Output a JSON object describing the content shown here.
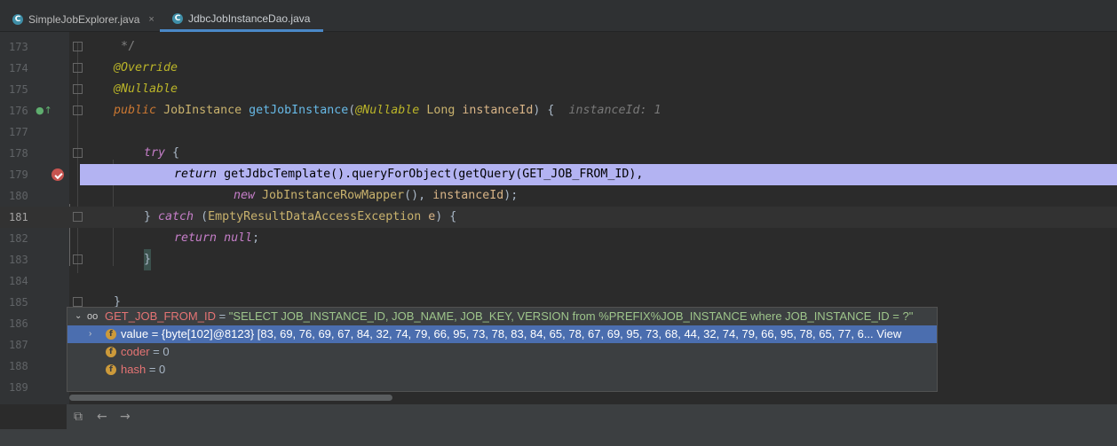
{
  "tabs": [
    {
      "label": "SimpleJobExplorer.java",
      "icon": "c-class-icon",
      "close": "×"
    },
    {
      "label": "JdbcJobInstanceDao.java",
      "icon": "c-class-icon",
      "close": ""
    }
  ],
  "lines": [
    {
      "n": "173"
    },
    {
      "n": "174"
    },
    {
      "n": "175"
    },
    {
      "n": "176"
    },
    {
      "n": "177"
    },
    {
      "n": "178"
    },
    {
      "n": "179"
    },
    {
      "n": "180"
    },
    {
      "n": "181"
    },
    {
      "n": "182"
    },
    {
      "n": "183"
    },
    {
      "n": "184"
    },
    {
      "n": "185"
    },
    {
      "n": "186"
    },
    {
      "n": "187"
    },
    {
      "n": "188"
    },
    {
      "n": "189"
    }
  ],
  "code": {
    "l173": "*/",
    "l174": "@Override",
    "l175": "@Nullable",
    "l176_public": "public",
    "l176_type": "JobInstance",
    "l176_method": "getJobInstance",
    "l176_paren": "(",
    "l176_ann": "@Nullable",
    "l176_long": "Long",
    "l176_param": "instanceId",
    "l176_close": ") {",
    "l176_hint": "instanceId: 1",
    "l178_try": "try",
    "l178_brace": "{",
    "l179_return": "return",
    "l179_rest": "getJdbcTemplate().queryForObject(getQuery(GET_JOB_FROM_ID),",
    "l180_new": "new",
    "l180_type": "JobInstanceRowMapper",
    "l180_rest": "(), ",
    "l180_param": "instanceId",
    "l180_end": ");",
    "l181_brace": "}",
    "l181_catch": "catch",
    "l181_open": " (",
    "l181_type": "EmptyResultDataAccessException",
    "l181_e": "e",
    "l181_close": ") {",
    "l182_return": "return",
    "l182_null": "null",
    "l182_semi": ";",
    "l183": "}",
    "l185": "}"
  },
  "popup": {
    "root_name": "GET_JOB_FROM_ID",
    "root_eq": " = ",
    "root_value": "\"SELECT JOB_INSTANCE_ID, JOB_NAME, JOB_KEY, VERSION from %PREFIX%JOB_INSTANCE where JOB_INSTANCE_ID = ?\"",
    "rows": [
      {
        "name": "value",
        "value": " = {byte[102]@8123} [83, 69, 76, 69, 67, 84, 32, 74, 79, 66, 95, 73, 78, 83, 84, 65, 78, 67, 69, 95, 73, 68, 44, 32, 74, 79, 66, 95, 78, 65, 77, 6...",
        "link": "View",
        "icon": "field-icon"
      },
      {
        "name": "coder",
        "value": " = 0",
        "icon": "field-icon"
      },
      {
        "name": "hash",
        "value": " = 0",
        "icon": "field-icon"
      }
    ]
  },
  "colors": {
    "highlight": "#b3b3f2",
    "selected_row": "#4b6eaf",
    "breakpoint": "#c75450",
    "active_tab": "#4a88c7"
  }
}
